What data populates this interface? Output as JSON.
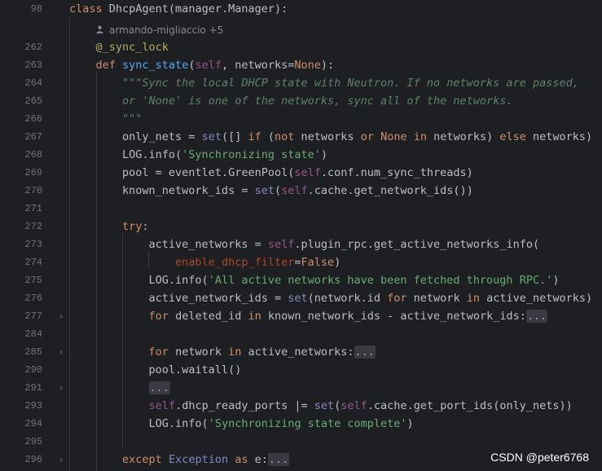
{
  "author_hint": {
    "icon": "person-icon",
    "text": "armando-migliaccio +5"
  },
  "lines": [
    {
      "num": "98",
      "fold": false,
      "tokens": [
        {
          "t": "class ",
          "c": "kw"
        },
        {
          "t": "DhcpAgent(manager.Manager):",
          "c": ""
        }
      ]
    },
    {
      "num": "262",
      "fold": false,
      "tokens": [
        {
          "t": "    ",
          "c": ""
        },
        {
          "t": "@_sync_lock",
          "c": "deco"
        }
      ]
    },
    {
      "num": "263",
      "fold": false,
      "tokens": [
        {
          "t": "    ",
          "c": ""
        },
        {
          "t": "def ",
          "c": "kw"
        },
        {
          "t": "sync_state",
          "c": "fn"
        },
        {
          "t": "(",
          "c": ""
        },
        {
          "t": "self",
          "c": "self"
        },
        {
          "t": ", networks=",
          "c": ""
        },
        {
          "t": "None",
          "c": "kw"
        },
        {
          "t": "):",
          "c": ""
        }
      ]
    },
    {
      "num": "264",
      "fold": false,
      "tokens": [
        {
          "t": "        ",
          "c": ""
        },
        {
          "t": "\"\"\"Sync the local DHCP state with Neutron. If no networks are passed,",
          "c": "doc"
        }
      ]
    },
    {
      "num": "265",
      "fold": false,
      "tokens": [
        {
          "t": "        ",
          "c": ""
        },
        {
          "t": "or 'None' is one of the networks, sync all of the networks.",
          "c": "doc"
        }
      ]
    },
    {
      "num": "266",
      "fold": false,
      "tokens": [
        {
          "t": "        ",
          "c": ""
        },
        {
          "t": "\"\"\"",
          "c": "doc"
        }
      ]
    },
    {
      "num": "267",
      "fold": false,
      "tokens": [
        {
          "t": "        only_nets = ",
          "c": ""
        },
        {
          "t": "set",
          "c": "builtin"
        },
        {
          "t": "([] ",
          "c": ""
        },
        {
          "t": "if ",
          "c": "kw"
        },
        {
          "t": "(",
          "c": ""
        },
        {
          "t": "not ",
          "c": "kw"
        },
        {
          "t": "networks ",
          "c": ""
        },
        {
          "t": "or ",
          "c": "kw"
        },
        {
          "t": "None ",
          "c": "kw"
        },
        {
          "t": "in ",
          "c": "kw"
        },
        {
          "t": "networks) ",
          "c": ""
        },
        {
          "t": "else ",
          "c": "kw"
        },
        {
          "t": "networks)",
          "c": ""
        }
      ]
    },
    {
      "num": "268",
      "fold": false,
      "tokens": [
        {
          "t": "        LOG.info(",
          "c": ""
        },
        {
          "t": "'Synchronizing state'",
          "c": "str"
        },
        {
          "t": ")",
          "c": ""
        }
      ]
    },
    {
      "num": "269",
      "fold": false,
      "tokens": [
        {
          "t": "        pool = eventlet.GreenPool(",
          "c": ""
        },
        {
          "t": "self",
          "c": "self"
        },
        {
          "t": ".conf.num_sync_threads)",
          "c": ""
        }
      ]
    },
    {
      "num": "270",
      "fold": false,
      "tokens": [
        {
          "t": "        known_network_ids = ",
          "c": ""
        },
        {
          "t": "set",
          "c": "builtin"
        },
        {
          "t": "(",
          "c": ""
        },
        {
          "t": "self",
          "c": "self"
        },
        {
          "t": ".cache.get_network_ids())",
          "c": ""
        }
      ]
    },
    {
      "num": "271",
      "fold": false,
      "tokens": []
    },
    {
      "num": "272",
      "fold": false,
      "tokens": [
        {
          "t": "        ",
          "c": ""
        },
        {
          "t": "try",
          "c": "kw"
        },
        {
          "t": ":",
          "c": ""
        }
      ]
    },
    {
      "num": "273",
      "fold": false,
      "tokens": [
        {
          "t": "            active_networks = ",
          "c": ""
        },
        {
          "t": "self",
          "c": "self"
        },
        {
          "t": ".plugin_rpc.get_active_networks_info(",
          "c": ""
        }
      ]
    },
    {
      "num": "274",
      "fold": false,
      "tokens": [
        {
          "t": "                ",
          "c": ""
        },
        {
          "t": "enable_dhcp_filter",
          "c": "named"
        },
        {
          "t": "=",
          "c": ""
        },
        {
          "t": "False",
          "c": "kw"
        },
        {
          "t": ")",
          "c": ""
        }
      ]
    },
    {
      "num": "275",
      "fold": false,
      "tokens": [
        {
          "t": "            LOG.info(",
          "c": ""
        },
        {
          "t": "'All active networks have been fetched through RPC.'",
          "c": "str"
        },
        {
          "t": ")",
          "c": ""
        }
      ]
    },
    {
      "num": "276",
      "fold": false,
      "tokens": [
        {
          "t": "            active_network_ids = ",
          "c": ""
        },
        {
          "t": "set",
          "c": "builtin"
        },
        {
          "t": "(network.id ",
          "c": ""
        },
        {
          "t": "for ",
          "c": "kw"
        },
        {
          "t": "network ",
          "c": ""
        },
        {
          "t": "in ",
          "c": "kw"
        },
        {
          "t": "active_networks)",
          "c": ""
        }
      ]
    },
    {
      "num": "277",
      "fold": true,
      "tokens": [
        {
          "t": "            ",
          "c": ""
        },
        {
          "t": "for ",
          "c": "kw"
        },
        {
          "t": "deleted_id ",
          "c": ""
        },
        {
          "t": "in ",
          "c": "kw"
        },
        {
          "t": "known_network_ids - active_network_ids:",
          "c": ""
        },
        {
          "t": "...",
          "c": "fold-ph"
        }
      ]
    },
    {
      "num": "284",
      "fold": false,
      "tokens": []
    },
    {
      "num": "285",
      "fold": true,
      "tokens": [
        {
          "t": "            ",
          "c": ""
        },
        {
          "t": "for ",
          "c": "kw"
        },
        {
          "t": "network ",
          "c": ""
        },
        {
          "t": "in ",
          "c": "kw"
        },
        {
          "t": "active_networks:",
          "c": ""
        },
        {
          "t": "...",
          "c": "fold-ph"
        }
      ]
    },
    {
      "num": "290",
      "fold": false,
      "tokens": [
        {
          "t": "            pool.waitall()",
          "c": ""
        }
      ]
    },
    {
      "num": "291",
      "fold": true,
      "tokens": [
        {
          "t": "            ",
          "c": ""
        },
        {
          "t": "...",
          "c": "fold-ph"
        }
      ]
    },
    {
      "num": "293",
      "fold": false,
      "tokens": [
        {
          "t": "            ",
          "c": ""
        },
        {
          "t": "self",
          "c": "self"
        },
        {
          "t": ".dhcp_ready_ports |= ",
          "c": ""
        },
        {
          "t": "set",
          "c": "builtin"
        },
        {
          "t": "(",
          "c": ""
        },
        {
          "t": "self",
          "c": "self"
        },
        {
          "t": ".cache.get_port_ids(only_nets))",
          "c": ""
        }
      ]
    },
    {
      "num": "294",
      "fold": false,
      "tokens": [
        {
          "t": "            LOG.info(",
          "c": ""
        },
        {
          "t": "'Synchronizing state complete'",
          "c": "str"
        },
        {
          "t": ")",
          "c": ""
        }
      ]
    },
    {
      "num": "295",
      "fold": false,
      "tokens": []
    },
    {
      "num": "296",
      "fold": true,
      "tokens": [
        {
          "t": "        ",
          "c": ""
        },
        {
          "t": "except ",
          "c": "kw"
        },
        {
          "t": "Exception ",
          "c": "builtin"
        },
        {
          "t": "as ",
          "c": "kw"
        },
        {
          "t": "e:",
          "c": ""
        },
        {
          "t": "...",
          "c": "fold-ph"
        }
      ]
    }
  ],
  "watermark": "CSDN @peter6768",
  "colors": {
    "background": "#1e1f22",
    "keyword": "#cf8e6d",
    "function": "#56a8f5",
    "string": "#6aab73",
    "docstring": "#5f826b",
    "self": "#94558d",
    "decorator": "#b3ae60"
  }
}
